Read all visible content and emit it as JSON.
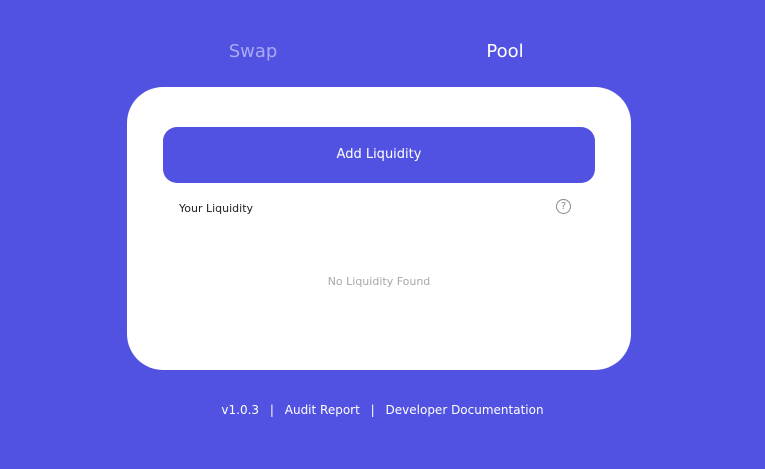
{
  "tabs": {
    "swap": "Swap",
    "pool": "Pool"
  },
  "pool": {
    "add_button": "Add Liquidity",
    "your_liquidity": "Your Liquidity",
    "help_icon": "question-circle-icon",
    "help_glyph": "?",
    "empty_state": "No Liquidity Found"
  },
  "footer": {
    "version": "v1.0.3",
    "separator": "|",
    "audit": "Audit Report",
    "docs": "Developer Documentation"
  },
  "colors": {
    "background": "#5152e2",
    "card": "#ffffff",
    "inactive_tab": "#a9aaf3",
    "active_tab": "#ffffff"
  }
}
